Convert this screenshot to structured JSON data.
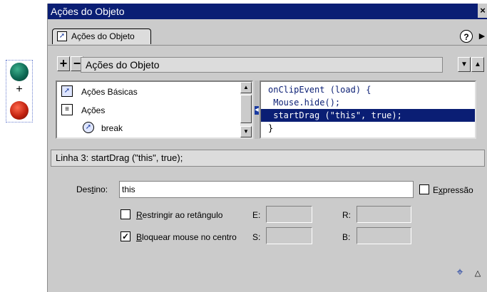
{
  "window": {
    "title": "Ações do Objeto",
    "close_glyph": "×"
  },
  "tab": {
    "label": "Ações do Objeto",
    "icon": "actions-arrow-icon"
  },
  "help": {
    "glyph": "?"
  },
  "toolbar": {
    "add_glyph": "+",
    "remove_glyph": "−",
    "panel_title": "Ações do Objeto",
    "down_glyph": "▼",
    "up_glyph": "▲"
  },
  "actions_list": {
    "items": [
      {
        "label": "Ações Básicas",
        "icon": "book-arrow-icon"
      },
      {
        "label": "Ações",
        "icon": "book-icon"
      },
      {
        "label": "break",
        "icon": "action-circle-icon"
      }
    ]
  },
  "code": {
    "lines": [
      "onClipEvent (load) {",
      " Mouse.hide();",
      " startDrag (\"this\", true);",
      "}"
    ],
    "selected_line": 3
  },
  "status": {
    "text": "Linha 3: startDrag (\"this\", true);"
  },
  "params": {
    "target": {
      "label_pre": "Des",
      "label_u": "t",
      "label_post": "ino:",
      "value": "this"
    },
    "expression": {
      "label_pre": "E",
      "label_u": "x",
      "label_post": "pressão",
      "checked": false
    },
    "constrain": {
      "label_u": "R",
      "label_post": "estringir ao retângulo",
      "checked": false
    },
    "lock_center": {
      "label_u": "B",
      "label_post": "loquear mouse no centro",
      "checked": true,
      "check_glyph": "✓"
    },
    "fields": {
      "e_label": "E:",
      "r_label": "R:",
      "s_label": "S:",
      "b_label": "B:"
    }
  },
  "footer": {
    "target_glyph": "⌖",
    "collapse_glyph": "△"
  },
  "colors": {
    "titlebar": "#0a1e74",
    "panel_bg": "#cbcbcb",
    "selection": "#0a1e74"
  }
}
